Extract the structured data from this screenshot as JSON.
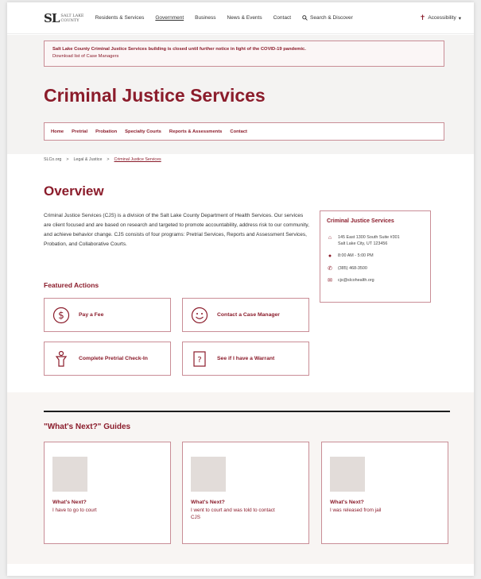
{
  "header": {
    "logo_mark": "SL",
    "logo_line1": "SALT LAKE",
    "logo_line2": "COUNTY",
    "nav": [
      "Residents & Services",
      "Government",
      "Business",
      "News & Events",
      "Contact"
    ],
    "search_label": "Search & Discover",
    "accessibility_label": "Accessibility"
  },
  "alert": {
    "message": "Salt Lake County Criminal Justice Services building is closed until further notice in light of the COVID-19 pandemic.",
    "link": "Download list of Case Managers"
  },
  "page_title": "Criminal Justice Services",
  "tabs": [
    "Home",
    "Pretrial",
    "Probation",
    "Specialty Courts",
    "Reports & Assessments",
    "Contact"
  ],
  "breadcrumb": [
    "SLCo.org",
    "Legal & Justice",
    "Criminal Justice Services"
  ],
  "overview": {
    "heading": "Overview",
    "body": "Criminal Justice Services (CJS) is a division of the Salt Lake County Department of Health Services. Our services are client focused and are based on research and targeted to promote accountability, address risk to our community, and achieve behavior change. CJS consists of four programs: Pretrial Services, Reports and Assessment Services, Probation, and Collaborative Courts."
  },
  "contact": {
    "title": "Criminal Justice Services",
    "address_line1": "145 East 1300 South Suite #301",
    "address_line2": "Salt Lake City, UT 123456",
    "hours": "8:00 AM - 5:00 PM",
    "phone": "(385) 468-3500",
    "email": "cjs@slcohealth.org"
  },
  "featured": {
    "heading": "Featured Actions",
    "actions": [
      {
        "label": "Pay a Fee",
        "icon": "dollar-icon"
      },
      {
        "label": "Contact a Case Manager",
        "icon": "smiley-icon"
      },
      {
        "label": "Complete Pretrial Check-In",
        "icon": "person-icon"
      },
      {
        "label": "See if I have a Warrant",
        "icon": "question-document-icon"
      }
    ]
  },
  "guides": {
    "heading": "\"What's Next?\" Guides",
    "items": [
      {
        "q": "What's Next?",
        "text": "I have to go to court"
      },
      {
        "q": "What's Next?",
        "text": "I went to court and was told to contact CJS"
      },
      {
        "q": "What's Next?",
        "text": "I was released from jail"
      }
    ]
  },
  "colors": {
    "brand": "#8b1c2b",
    "border": "#c98d96",
    "band": "#f4f3f2"
  }
}
